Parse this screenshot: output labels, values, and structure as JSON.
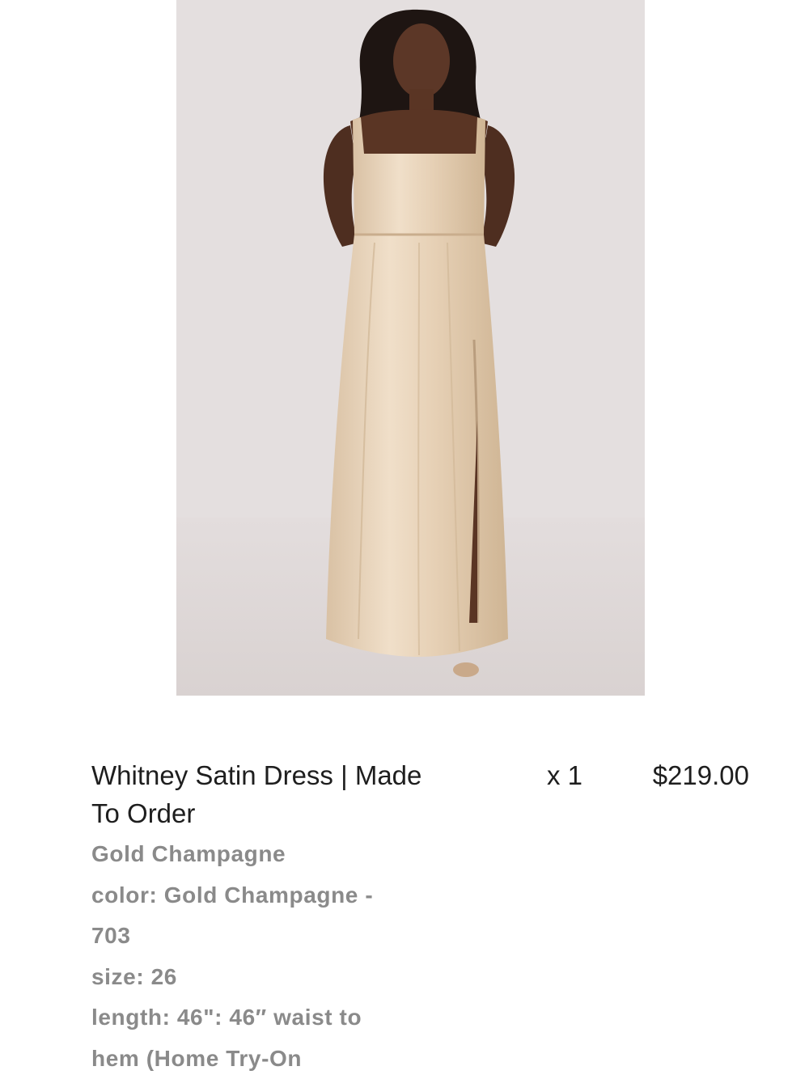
{
  "product": {
    "image_alt": "Model wearing a champagne satin maxi dress",
    "title": "Whitney Satin Dress | Made To Order",
    "quantity": "x 1",
    "price": "$219.00",
    "variant": "Gold Champagne",
    "color_line": "color: Gold Champagne - 703",
    "size_line": "size: 26",
    "length_line": "length: 46\": 46″ waist to hem (Home Try-On"
  },
  "colors": {
    "background": "#ffffff",
    "photo_backdrop": "#e4dfdf",
    "dress": "#e7d2b8",
    "title_text": "#1e1e1e",
    "detail_text": "#8a8a8a"
  }
}
